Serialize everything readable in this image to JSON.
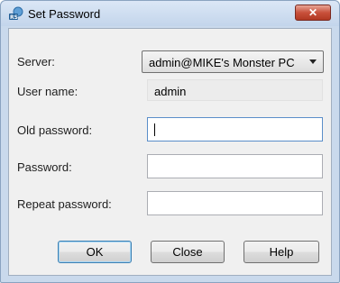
{
  "window": {
    "title": "Set Password",
    "close_symbol": "✕",
    "app_icon": "rs-key-icon"
  },
  "form": {
    "server": {
      "label": "Server:",
      "value": "admin@MIKE's Monster PC"
    },
    "user_name": {
      "label": "User name:",
      "value": "admin"
    },
    "old_password": {
      "label": "Old password:",
      "value": ""
    },
    "password": {
      "label": "Password:",
      "value": ""
    },
    "repeat_password": {
      "label": "Repeat password:",
      "value": ""
    }
  },
  "buttons": {
    "ok": "OK",
    "close": "Close",
    "help": "Help"
  },
  "colors": {
    "title_gradient_top": "#dbe7f6",
    "close_button": "#c8503b",
    "focus_border": "#5a8ec9"
  }
}
